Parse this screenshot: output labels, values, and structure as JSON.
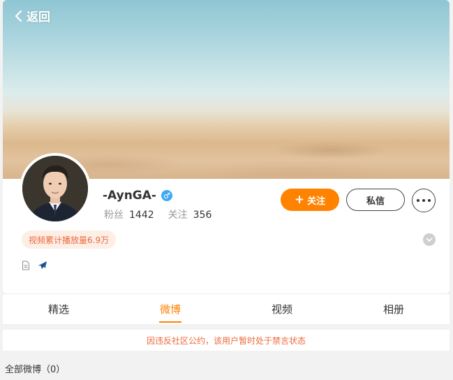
{
  "header": {
    "back_label": "返回"
  },
  "profile": {
    "name": "-AynGA-",
    "gender_symbol": "♂",
    "followers_label": "粉丝",
    "followers_count": "1442",
    "following_label": "关注",
    "following_count": "356"
  },
  "actions": {
    "follow_label": "关注",
    "message_label": "私信"
  },
  "tag": {
    "text": "视频累计播放量6.9万"
  },
  "tabs": [
    {
      "label": "精选"
    },
    {
      "label": "微博"
    },
    {
      "label": "视频"
    },
    {
      "label": "相册"
    }
  ],
  "active_tab": "微博",
  "notice": {
    "text": "因违反社区公约，该用户暂时处于禁言状态"
  },
  "posts": {
    "all_label": "全部微博（0）"
  },
  "colors": {
    "accent": "#ff8200",
    "notice_text": "#ec6a3b",
    "tag_bg": "#fdeee6",
    "gender": "#3fa9f5"
  }
}
